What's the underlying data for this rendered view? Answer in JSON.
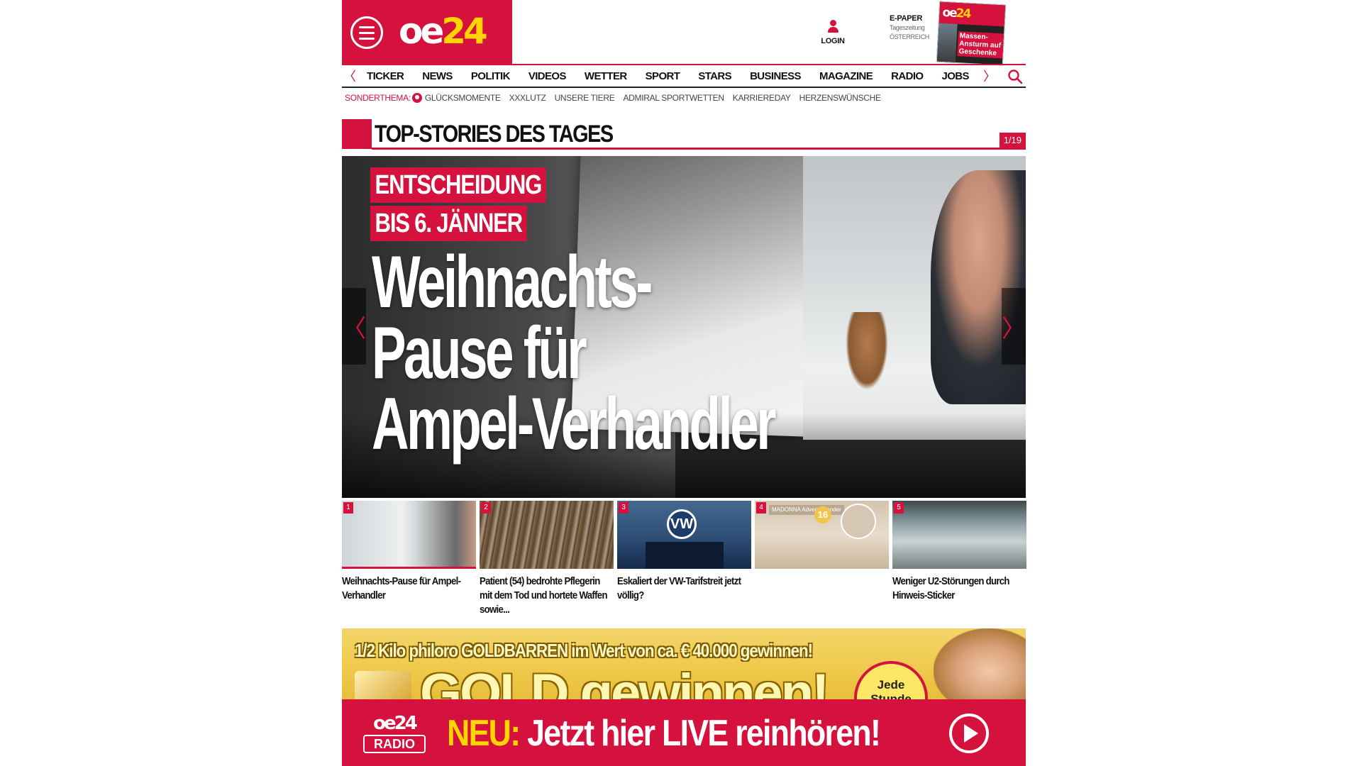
{
  "brand": {
    "logo_oe": "oe",
    "logo_24": "24",
    "accent": "#d5123d",
    "yellow": "#ffd400"
  },
  "header": {
    "login_label": "LOGIN",
    "epaper_title": "E-PAPER",
    "epaper_sub1": "Tageszeitung",
    "epaper_sub2": "ÖSTERREICH",
    "epaper_thumb_headline": "Massen-Ansturm auf Geschenke"
  },
  "nav": {
    "items": [
      "TICKER",
      "NEWS",
      "POLITIK",
      "VIDEOS",
      "WETTER",
      "SPORT",
      "STARS",
      "BUSINESS",
      "MAGAZINE",
      "RADIO",
      "JOBS"
    ],
    "prev_arrow": "〈",
    "next_arrow": "〉"
  },
  "topics": {
    "label": "SONDERTHEMA:",
    "items": [
      "GLÜCKSMOMENTE",
      "XXXLUTZ",
      "UNSERE TIERE",
      "ADMIRAL SPORTWETTEN",
      "KARRIEREDAY",
      "HERZENSWÜNSCHE"
    ]
  },
  "section": {
    "title": "TOP-STORIES DES TAGES",
    "counter": "1/19"
  },
  "hero": {
    "kicker_line1": "ENTSCHEIDUNG",
    "kicker_line2": "BIS 6. JÄNNER",
    "headline_line1": "Weihnachts-",
    "headline_line2": "Pause für",
    "headline_line3": "Ampel-Verhandler",
    "prev": "〈",
    "next": "〉"
  },
  "thumbs": [
    {
      "num": "1",
      "caption": "Weihnachts-Pause für Ampel-Verhandler"
    },
    {
      "num": "2",
      "caption": "Patient (54) bedrohte Pflegerin mit dem Tod und hortete Waffen sowie..."
    },
    {
      "num": "3",
      "caption": "Eskaliert der VW-Tarifstreit jetzt völlig?"
    },
    {
      "num": "4",
      "caption": "",
      "img_badge": "MADONNA Adventkalender",
      "img_star": "16"
    },
    {
      "num": "5",
      "caption": "Weniger U2-Störungen durch Hinweis-Sticker"
    }
  ],
  "ad": {
    "line1": "1/2 Kilo philoro GOLDBARREN im Wert von ca. € 40.000 gewinnen!",
    "line2": "GOLD gewinnen!",
    "badge": "Jede Stunde"
  },
  "radio": {
    "logo_oe": "oe24",
    "logo_radio": "RADIO",
    "neu": "NEU:",
    "message": "Jetzt hier LIVE reinhören!"
  }
}
